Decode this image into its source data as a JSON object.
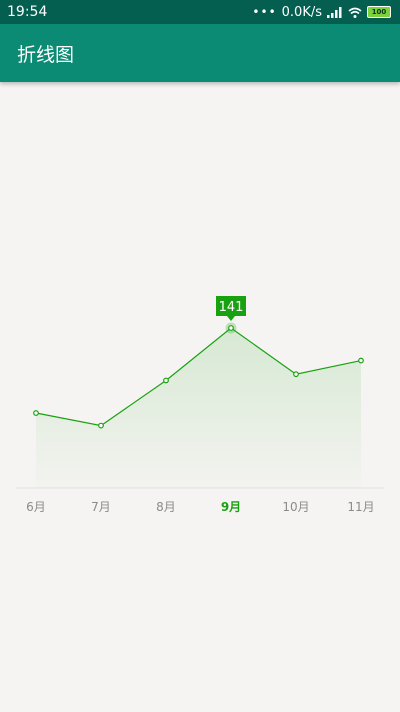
{
  "status_bar": {
    "time": "19:54",
    "dots": "•••",
    "network_speed": "0.0K/s",
    "battery": "100",
    "icons": [
      "signal-icon",
      "wifi-icon",
      "battery-icon"
    ]
  },
  "app_bar": {
    "title": "折线图",
    "color": "#0b8b73"
  },
  "chart_data": {
    "type": "line",
    "categories": [
      "6月",
      "7月",
      "8月",
      "9月",
      "10月",
      "11月"
    ],
    "values": [
      60,
      48,
      91,
      141,
      97,
      110
    ],
    "selected_index": 3,
    "selected_label": "141",
    "line_color": "#1aa112",
    "axis_color": "#e3e3e3",
    "ylim": [
      20,
      141
    ],
    "grid": false
  }
}
